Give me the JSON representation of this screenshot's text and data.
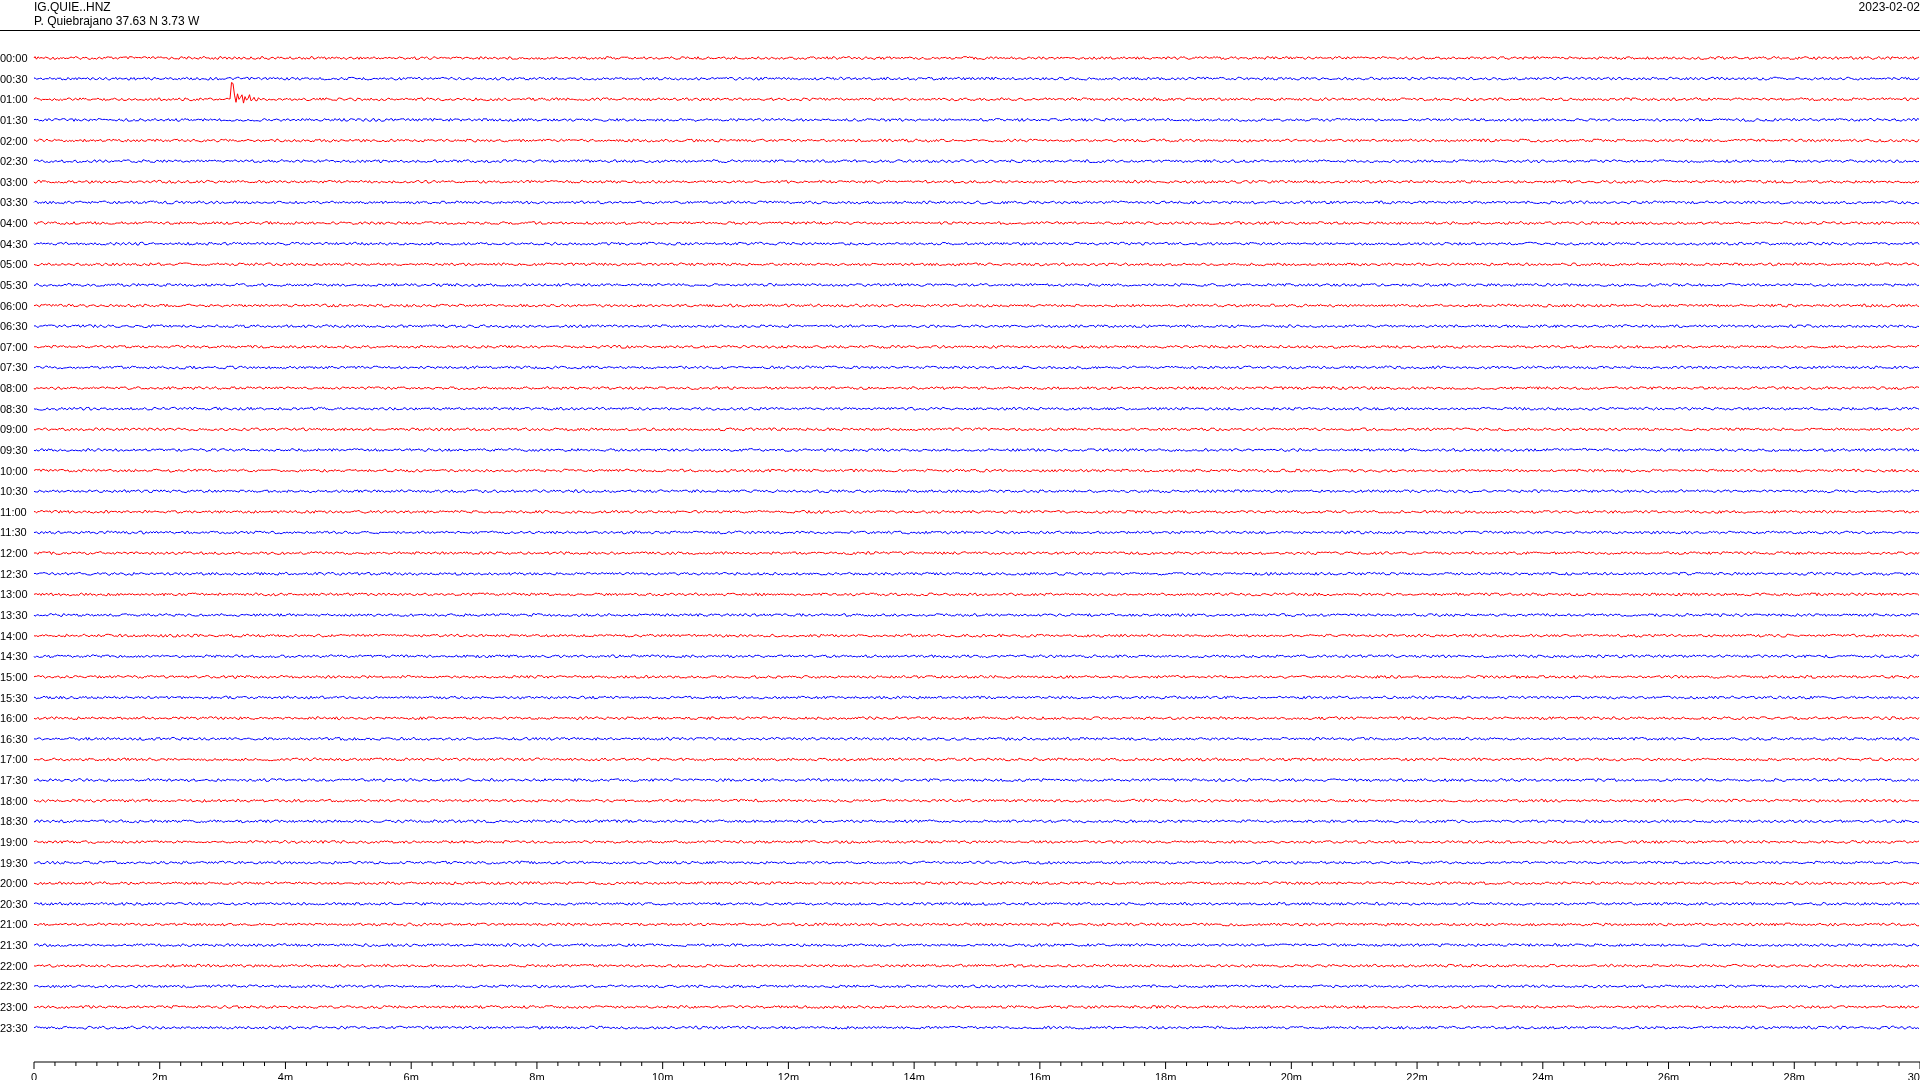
{
  "header": {
    "channel": "IG.QUIE..HNZ",
    "station": "P. Quiebrajano  37.63 N 3.73 W",
    "date": "2023-02-02"
  },
  "rows": [
    {
      "label": "00:00",
      "color": "#ff0000",
      "kind": "trace"
    },
    {
      "label": "00:30",
      "color": "#0000ff",
      "kind": "trace"
    },
    {
      "label": "01:00",
      "color": "#ff0000",
      "kind": "event"
    },
    {
      "label": "01:30",
      "color": "#0000ff",
      "kind": "trace"
    },
    {
      "label": "02:00",
      "color": "#ff0000",
      "kind": "trace"
    },
    {
      "label": "02:30",
      "color": "#0000ff",
      "kind": "trace"
    },
    {
      "label": "03:00",
      "color": "#ff0000",
      "kind": "trace"
    },
    {
      "label": "03:30",
      "color": "#0000ff",
      "kind": "trace"
    },
    {
      "label": "04:00",
      "color": "#ff0000",
      "kind": "trace"
    },
    {
      "label": "04:30",
      "color": "#0000ff",
      "kind": "trace"
    },
    {
      "label": "05:00",
      "color": "#ff0000",
      "kind": "trace"
    },
    {
      "label": "05:30",
      "color": "#0000ff",
      "kind": "trace"
    },
    {
      "label": "06:00",
      "color": "#ff0000",
      "kind": "trace"
    },
    {
      "label": "06:30",
      "color": "#0000ff",
      "kind": "trace"
    },
    {
      "label": "07:00",
      "color": "#ff0000",
      "kind": "trace"
    },
    {
      "label": "07:30",
      "color": "#0000ff",
      "kind": "trace"
    },
    {
      "label": "08:00",
      "color": "#ff0000",
      "kind": "trace"
    },
    {
      "label": "08:30",
      "color": "#0000ff",
      "kind": "trace"
    },
    {
      "label": "09:00",
      "color": "#ff0000",
      "kind": "trace"
    },
    {
      "label": "09:30",
      "color": "#0000ff",
      "kind": "trace"
    },
    {
      "label": "10:00",
      "color": "#ff0000",
      "kind": "trace"
    },
    {
      "label": "10:30",
      "color": "#0000ff",
      "kind": "trace"
    },
    {
      "label": "11:00",
      "color": "#ff0000",
      "kind": "trace"
    },
    {
      "label": "11:30",
      "color": "#0000ff",
      "kind": "trace"
    },
    {
      "label": "12:00",
      "color": "#ff0000",
      "kind": "trace"
    },
    {
      "label": "12:30",
      "color": "#0000ff",
      "kind": "trace"
    },
    {
      "label": "13:00",
      "color": "#ff0000",
      "kind": "trace"
    },
    {
      "label": "13:30",
      "color": "#0000ff",
      "kind": "trace"
    },
    {
      "label": "14:00",
      "color": "#ff0000",
      "kind": "trace"
    },
    {
      "label": "14:30",
      "color": "#0000ff",
      "kind": "trace"
    },
    {
      "label": "15:00",
      "color": "#ff0000",
      "kind": "trace"
    },
    {
      "label": "15:30",
      "color": "#0000ff",
      "kind": "trace"
    },
    {
      "label": "16:00",
      "color": "#ff0000",
      "kind": "trace"
    },
    {
      "label": "16:30",
      "color": "#0000ff",
      "kind": "trace"
    },
    {
      "label": "17:00",
      "color": "#ff0000",
      "kind": "trace"
    },
    {
      "label": "17:30",
      "color": "#0000ff",
      "kind": "trace"
    },
    {
      "label": "18:00",
      "color": "#ff0000",
      "kind": "trace"
    },
    {
      "label": "18:30",
      "color": "#0000ff",
      "kind": "trace"
    },
    {
      "label": "19:00",
      "color": "#ff0000",
      "kind": "trace"
    },
    {
      "label": "19:30",
      "color": "#0000ff",
      "kind": "trace"
    },
    {
      "label": "20:00",
      "color": "#ff0000",
      "kind": "trace"
    },
    {
      "label": "20:30",
      "color": "#0000ff",
      "kind": "trace"
    },
    {
      "label": "21:00",
      "color": "#ff0000",
      "kind": "trace"
    },
    {
      "label": "21:30",
      "color": "#0000ff",
      "kind": "trace"
    },
    {
      "label": "22:00",
      "color": "#ff0000",
      "kind": "trace"
    },
    {
      "label": "22:30",
      "color": "#0000ff",
      "kind": "trace"
    },
    {
      "label": "23:00",
      "color": "#ff0000",
      "kind": "trace"
    },
    {
      "label": "23:30",
      "color": "#0000ff",
      "kind": "trace"
    }
  ],
  "time_axis": {
    "labels": [
      "0",
      "2m",
      "4m",
      "6m",
      "8m",
      "10m",
      "12m",
      "14m",
      "16m",
      "18m",
      "20m",
      "22m",
      "24m",
      "26m",
      "28m",
      "30"
    ]
  }
}
